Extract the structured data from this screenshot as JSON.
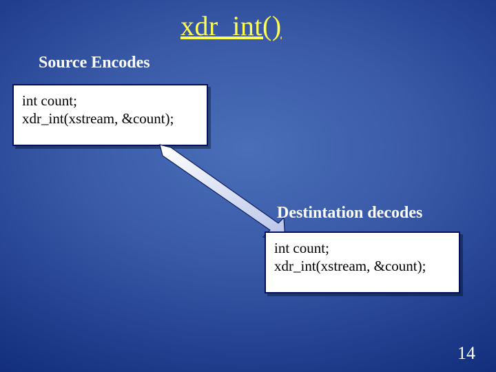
{
  "title": "xdr_int()",
  "labels": {
    "source": "Source Encodes",
    "dest": "Destintation decodes"
  },
  "code": {
    "source": {
      "line1": "int count;",
      "line2": "xdr_int(xstream, &count);"
    },
    "dest": {
      "line1": "int count;",
      "line2": "xdr_int(xstream, &count);"
    }
  },
  "page_number": "14"
}
